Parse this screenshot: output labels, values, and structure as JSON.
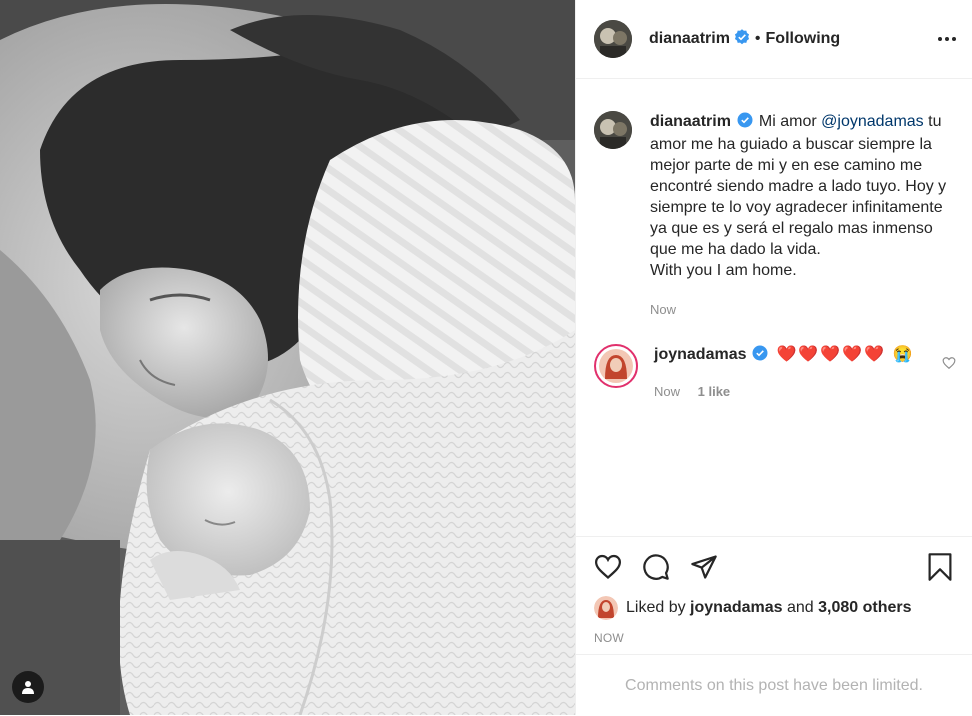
{
  "post": {
    "author": "dianaatrim",
    "follow_status": "Following",
    "separator": "•",
    "caption": {
      "author": "dianaatrim",
      "text_before_mention": "Mi amor",
      "mention": "@joynadamas",
      "text_after_mention": "tu amor me ha guiado a buscar siempre la mejor parte de mi y en ese camino me encontré siendo madre a lado tuyo. Hoy y siempre te lo voy agradecer infinitamente ya que es y será el regalo mas inmenso que me ha dado la vida.",
      "last_line": "With you I am home.",
      "time": "Now"
    },
    "reply": {
      "author": "joynadamas",
      "text": "❤️❤️❤️❤️❤️ 😭",
      "time": "Now",
      "likes": "1 like"
    },
    "likes": {
      "prefix": "Liked by",
      "user": "joynadamas",
      "and": "and",
      "others": "3,080 others"
    },
    "timestamp": "NOW",
    "comments_limited": "Comments on this post have been limited."
  },
  "colors": {
    "verified": "#3897f0",
    "mention": "#00376b",
    "muted": "#8e8e8e",
    "heart": "#ed4956"
  },
  "icons": [
    "more-icon",
    "heart-icon",
    "comment-icon",
    "share-icon",
    "save-icon",
    "verified-icon",
    "user-tag-icon"
  ]
}
